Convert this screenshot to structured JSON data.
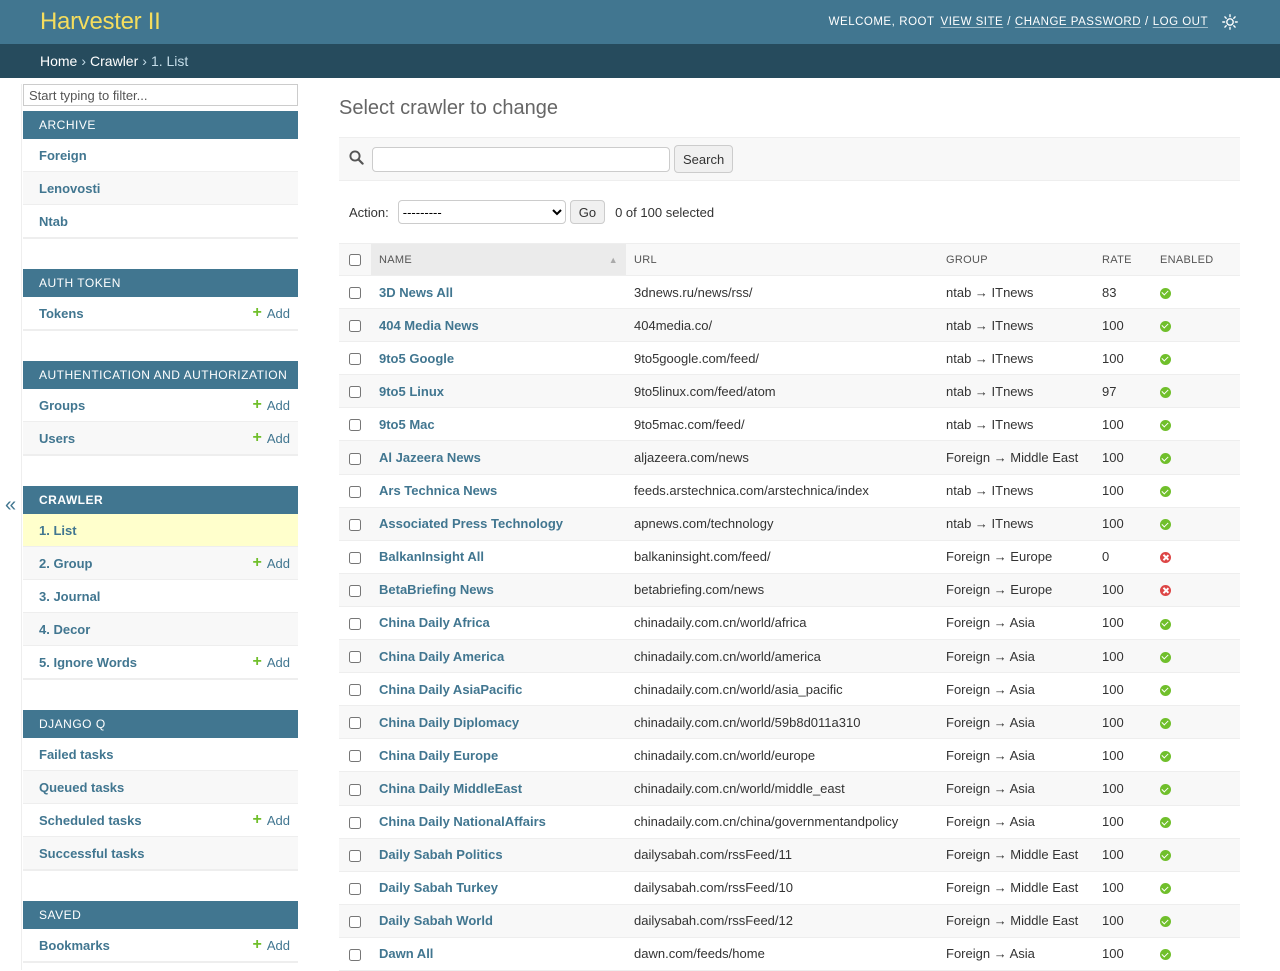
{
  "header": {
    "branding": "Harvester II",
    "welcome": "Welcome,",
    "username": "root",
    "view_site": "View site",
    "change_password": "Change password",
    "log_out": "Log out",
    "sep": "/"
  },
  "breadcrumbs": {
    "home": "Home",
    "app": "Crawler",
    "current": "1. List",
    "sep": "›"
  },
  "sidebar": {
    "filter_placeholder": "Start typing to filter...",
    "collapse_glyph": "«",
    "add_label": "Add",
    "modules": [
      {
        "caption": "Archive",
        "items": [
          {
            "label": "Foreign",
            "add": false
          },
          {
            "label": "Lenovosti",
            "add": false
          },
          {
            "label": "Ntab",
            "add": false
          }
        ]
      },
      {
        "caption": "Auth Token",
        "items": [
          {
            "label": "Tokens",
            "add": true
          }
        ]
      },
      {
        "caption": "Authentication and Authorization",
        "items": [
          {
            "label": "Groups",
            "add": true
          },
          {
            "label": "Users",
            "add": true
          }
        ]
      },
      {
        "caption": "Crawler",
        "active": true,
        "items": [
          {
            "label": "1. List",
            "add": false,
            "current": true
          },
          {
            "label": "2. Group",
            "add": true
          },
          {
            "label": "3. Journal",
            "add": false
          },
          {
            "label": "4. Decor",
            "add": false
          },
          {
            "label": "5. Ignore Words",
            "add": true
          }
        ]
      },
      {
        "caption": "Django Q",
        "items": [
          {
            "label": "Failed tasks",
            "add": false
          },
          {
            "label": "Queued tasks",
            "add": false
          },
          {
            "label": "Scheduled tasks",
            "add": true
          },
          {
            "label": "Successful tasks",
            "add": false
          }
        ]
      },
      {
        "caption": "Saved",
        "items": [
          {
            "label": "Bookmarks",
            "add": true
          }
        ]
      }
    ]
  },
  "main": {
    "title": "Select crawler to change",
    "search_button": "Search",
    "action_label": "Action:",
    "action_selected": "---------",
    "go_button": "Go",
    "selection_counter": "0 of 100 selected",
    "columns": [
      "Name",
      "URL",
      "Group",
      "Rate",
      "Enabled"
    ],
    "rows": [
      {
        "name": "3D News All",
        "url": "3dnews.ru/news/rss/",
        "group": "ntab → ITnews",
        "rate": "83",
        "enabled": true
      },
      {
        "name": "404 Media News",
        "url": "404media.co/",
        "group": "ntab → ITnews",
        "rate": "100",
        "enabled": true
      },
      {
        "name": "9to5 Google",
        "url": "9to5google.com/feed/",
        "group": "ntab → ITnews",
        "rate": "100",
        "enabled": true
      },
      {
        "name": "9to5 Linux",
        "url": "9to5linux.com/feed/atom",
        "group": "ntab → ITnews",
        "rate": "97",
        "enabled": true
      },
      {
        "name": "9to5 Mac",
        "url": "9to5mac.com/feed/",
        "group": "ntab → ITnews",
        "rate": "100",
        "enabled": true
      },
      {
        "name": "Al Jazeera News",
        "url": "aljazeera.com/news",
        "group": "Foreign → Middle East",
        "rate": "100",
        "enabled": true
      },
      {
        "name": "Ars Technica News",
        "url": "feeds.arstechnica.com/arstechnica/index",
        "group": "ntab → ITnews",
        "rate": "100",
        "enabled": true
      },
      {
        "name": "Associated Press Technology",
        "url": "apnews.com/technology",
        "group": "ntab → ITnews",
        "rate": "100",
        "enabled": true
      },
      {
        "name": "BalkanInsight All",
        "url": "balkaninsight.com/feed/",
        "group": "Foreign → Europe",
        "rate": "0",
        "enabled": false
      },
      {
        "name": "BetaBriefing News",
        "url": "betabriefing.com/news",
        "group": "Foreign → Europe",
        "rate": "100",
        "enabled": false
      },
      {
        "name": "China Daily Africa",
        "url": "chinadaily.com.cn/world/africa",
        "group": "Foreign → Asia",
        "rate": "100",
        "enabled": true
      },
      {
        "name": "China Daily America",
        "url": "chinadaily.com.cn/world/america",
        "group": "Foreign → Asia",
        "rate": "100",
        "enabled": true
      },
      {
        "name": "China Daily AsiaPacific",
        "url": "chinadaily.com.cn/world/asia_pacific",
        "group": "Foreign → Asia",
        "rate": "100",
        "enabled": true
      },
      {
        "name": "China Daily Diplomacy",
        "url": "chinadaily.com.cn/world/59b8d011a310",
        "group": "Foreign → Asia",
        "rate": "100",
        "enabled": true
      },
      {
        "name": "China Daily Europe",
        "url": "chinadaily.com.cn/world/europe",
        "group": "Foreign → Asia",
        "rate": "100",
        "enabled": true
      },
      {
        "name": "China Daily MiddleEast",
        "url": "chinadaily.com.cn/world/middle_east",
        "group": "Foreign → Asia",
        "rate": "100",
        "enabled": true
      },
      {
        "name": "China Daily NationalAffairs",
        "url": "chinadaily.com.cn/china/governmentandpolicy",
        "group": "Foreign → Asia",
        "rate": "100",
        "enabled": true
      },
      {
        "name": "Daily Sabah Politics",
        "url": "dailysabah.com/rssFeed/11",
        "group": "Foreign → Middle East",
        "rate": "100",
        "enabled": true
      },
      {
        "name": "Daily Sabah Turkey",
        "url": "dailysabah.com/rssFeed/10",
        "group": "Foreign → Middle East",
        "rate": "100",
        "enabled": true
      },
      {
        "name": "Daily Sabah World",
        "url": "dailysabah.com/rssFeed/12",
        "group": "Foreign → Middle East",
        "rate": "100",
        "enabled": true
      },
      {
        "name": "Dawn All",
        "url": "dawn.com/feeds/home",
        "group": "Foreign → Asia",
        "rate": "100",
        "enabled": true
      }
    ]
  },
  "colors": {
    "header_bg": "#417690",
    "branding": "#f5dd5d",
    "breadcrumbs_bg": "#264b5d",
    "link": "#417690",
    "add_plus": "#70bf2b",
    "enabled_yes": "#70bf2b",
    "enabled_no": "#dd4646",
    "current_row": "#ffffcc"
  },
  "icons": {
    "search": "search-icon",
    "theme": "theme-toggle-icon",
    "sort": "sort-ascending-icon",
    "enabled_yes": "check-circle-icon",
    "enabled_no": "x-circle-icon"
  }
}
